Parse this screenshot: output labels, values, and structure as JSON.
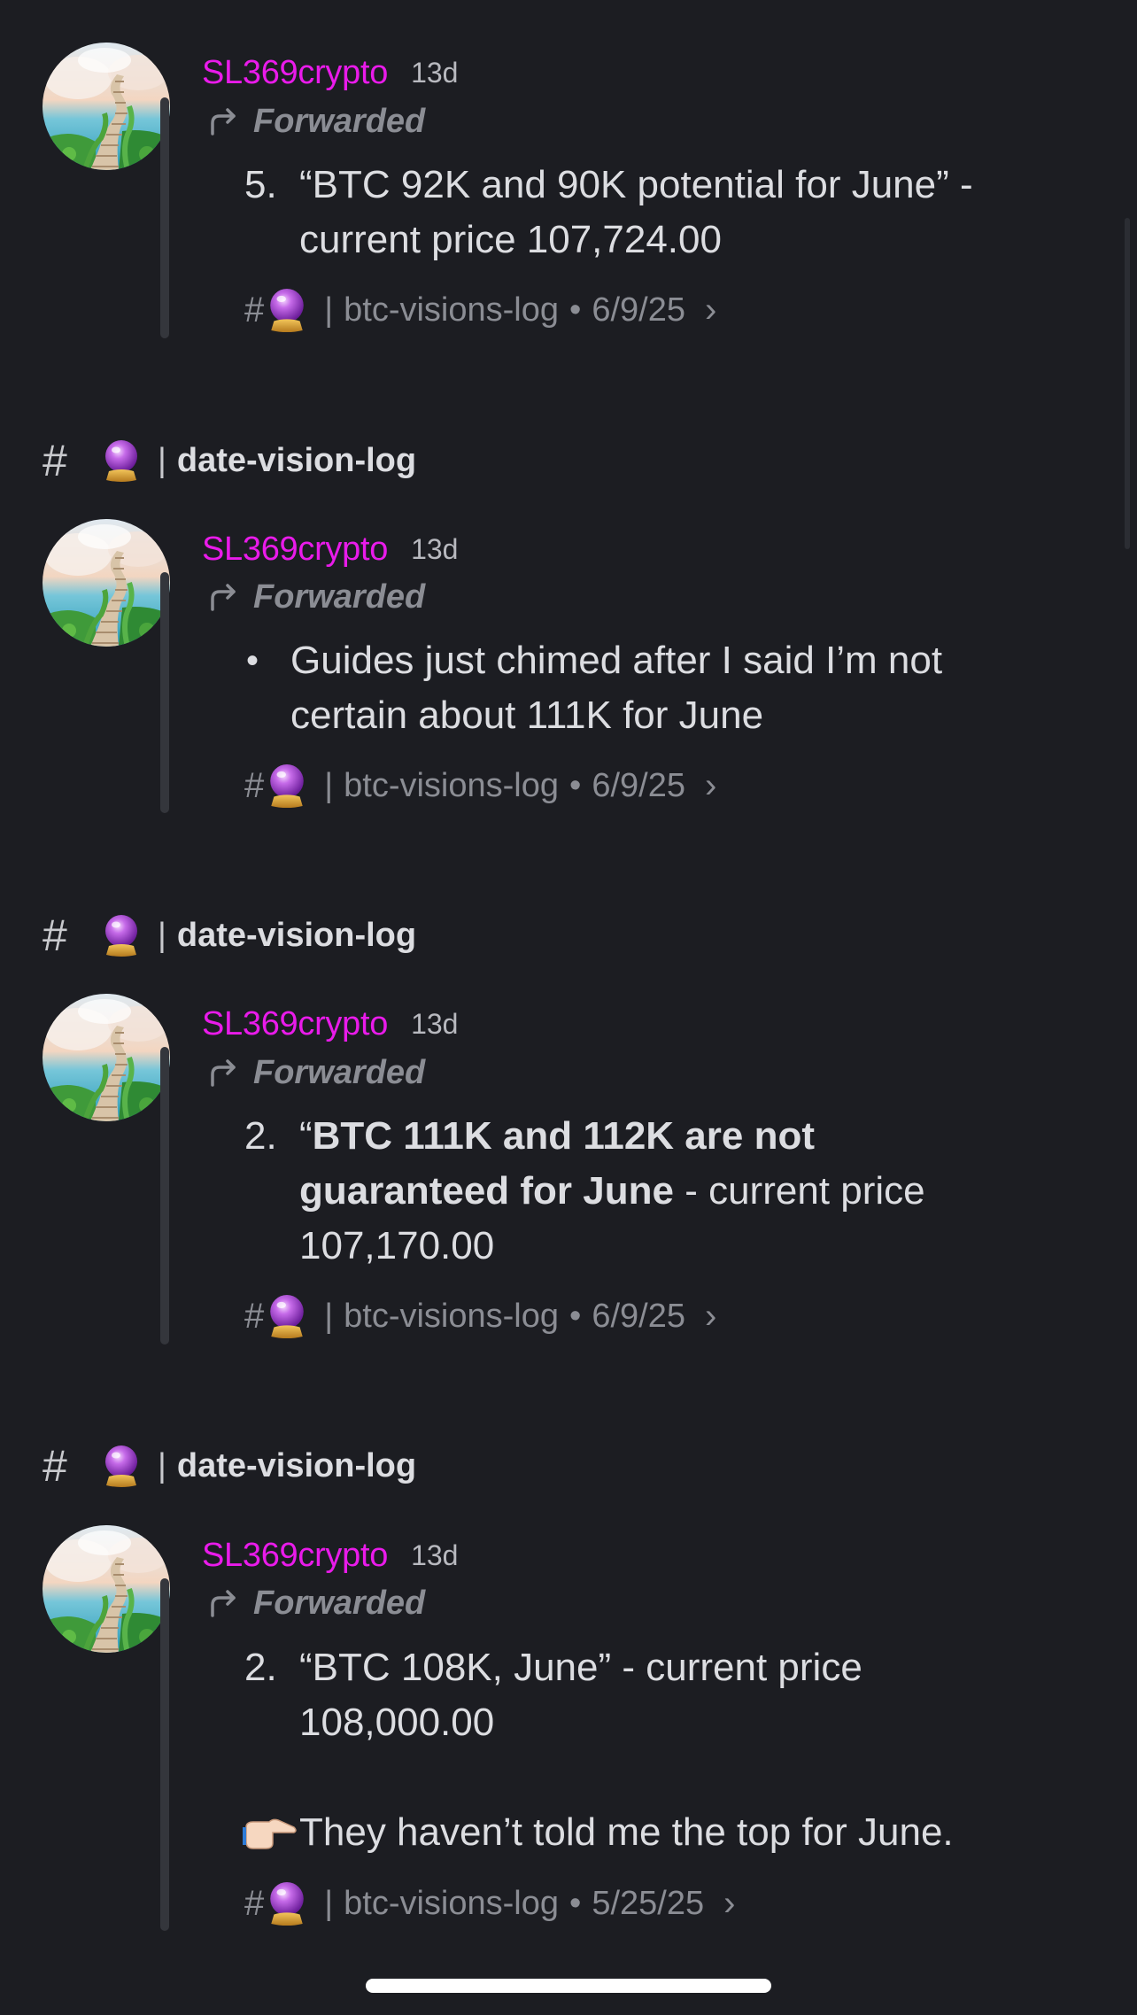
{
  "channel": {
    "hash": "#",
    "name": "date-vision-log",
    "pipe": "|"
  },
  "messages": [
    {
      "username": "SL369crypto",
      "timestamp": "13d",
      "forwarded_label": "Forwarded",
      "list_number": "5.",
      "text": "“BTC 92K and 90K potential for June” - current price 107,724.00",
      "source_hash": "#",
      "source_pipe": "|",
      "source_channel": "btc-visions-log",
      "source_sep": "•",
      "source_date": "6/9/25",
      "chevron": "›"
    },
    {
      "username": "SL369crypto",
      "timestamp": "13d",
      "forwarded_label": "Forwarded",
      "bullet": "•",
      "text": "Guides just chimed after I said I’m not certain about 111K for June",
      "source_hash": "#",
      "source_pipe": "|",
      "source_channel": "btc-visions-log",
      "source_sep": "•",
      "source_date": "6/9/25",
      "chevron": "›"
    },
    {
      "username": "SL369crypto",
      "timestamp": "13d",
      "forwarded_label": "Forwarded",
      "list_number": "2.",
      "text_open_quote": "“",
      "text_bold": "BTC 111K and 112K are not guaranteed for June",
      "text_rest": " - current price 107,170.00",
      "source_hash": "#",
      "source_pipe": "|",
      "source_channel": "btc-visions-log",
      "source_sep": "•",
      "source_date": "6/9/25",
      "chevron": "›"
    },
    {
      "username": "SL369crypto",
      "timestamp": "13d",
      "forwarded_label": "Forwarded",
      "list_number": "2.",
      "text": "“BTC 108K, June” - current price 108,000.00",
      "note": "They haven’t told me the top for June.",
      "source_hash": "#",
      "source_pipe": "|",
      "source_channel": "btc-visions-log",
      "source_sep": "•",
      "source_date": "5/25/25",
      "chevron": "›"
    }
  ],
  "icons": {
    "channel_emoji": "crystal-ball-icon",
    "forward": "forward-arrow-icon",
    "pointing": "pointing-right-hand-icon"
  },
  "colors": {
    "background": "#1c1d22",
    "username": "#e91bea",
    "muted": "#8b8d94",
    "text": "#dcdde1"
  }
}
